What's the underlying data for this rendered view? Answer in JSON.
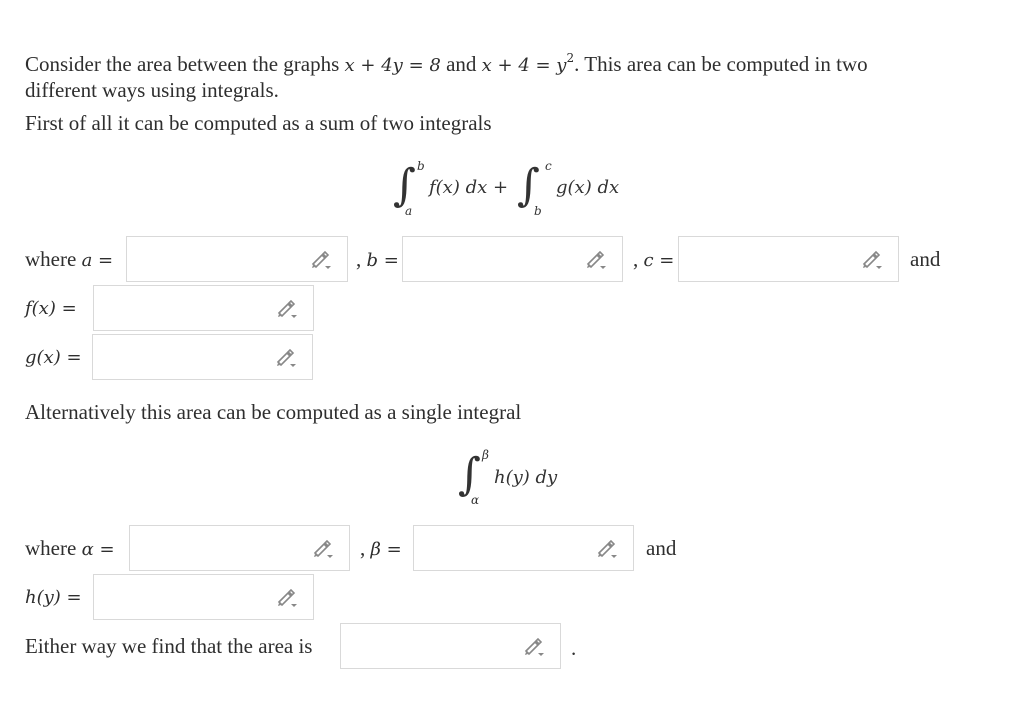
{
  "intro": {
    "l1_a": "Consider the area between the graphs ",
    "eq1": "x + 4y = 8",
    "l1_b": " and ",
    "eq2_base": "x + 4 = y",
    "eq2_exp": "2",
    "l1_c": ". This area can be computed in two",
    "l2": "different ways using integrals.",
    "l3": "First of all it can be computed as a sum of two integrals"
  },
  "integral1": {
    "upper1": "b",
    "lower1": "a",
    "integrand1": "f(x) dx +",
    "upper2": "c",
    "lower2": "b",
    "integrand2": "g(x) dx"
  },
  "row1": {
    "where": "where",
    "a_label": "a =",
    "b_sep": ",",
    "b_label": "b =",
    "c_sep": ",",
    "c_label": "c =",
    "and": "and"
  },
  "fx_label": "f(x) =",
  "gx_label": "g(x) =",
  "alt_text": "Alternatively this area can be computed as a single integral",
  "integral2": {
    "upper": "β",
    "lower": "α",
    "integrand": "h(y) dy"
  },
  "row2": {
    "where": "where",
    "alpha_label": "α =",
    "beta_sep": ",",
    "beta_label": "β =",
    "and": "and"
  },
  "hy_label": "h(y) =",
  "final": {
    "text": "Either way we find that the area is",
    "period": "."
  },
  "inputs": {
    "a": "",
    "b": "",
    "c": "",
    "f": "",
    "g": "",
    "alpha": "",
    "beta": "",
    "h": "",
    "area": ""
  },
  "icons": {
    "edit": "pencil-icon"
  },
  "colors": {
    "border": "#d9d9d9",
    "icon": "#888888",
    "text": "#2e2e2e"
  }
}
